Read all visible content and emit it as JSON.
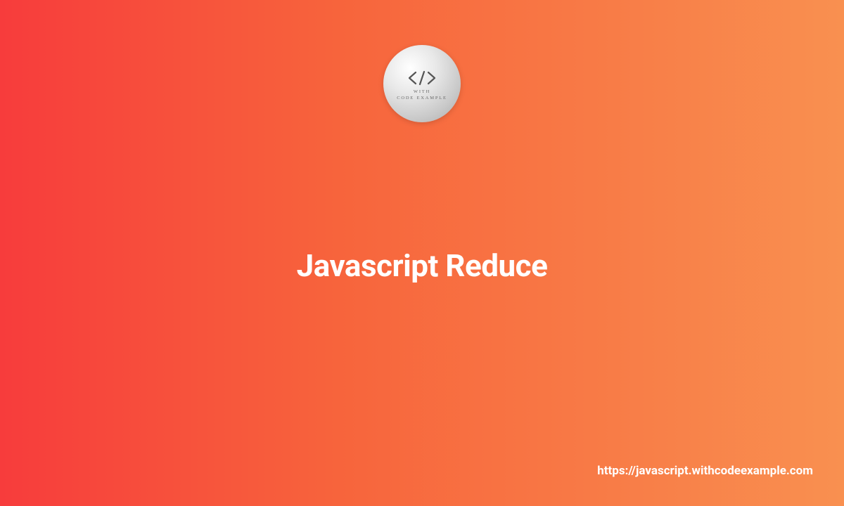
{
  "logo": {
    "line1": "WITH",
    "line2": "CODE EXAMPLE"
  },
  "title": "Javascript Reduce",
  "footer_url": "https://javascript.withcodeexample.com",
  "colors": {
    "gradient_start": "#f73c3c",
    "gradient_end": "#f99050",
    "text": "#ffffff"
  }
}
